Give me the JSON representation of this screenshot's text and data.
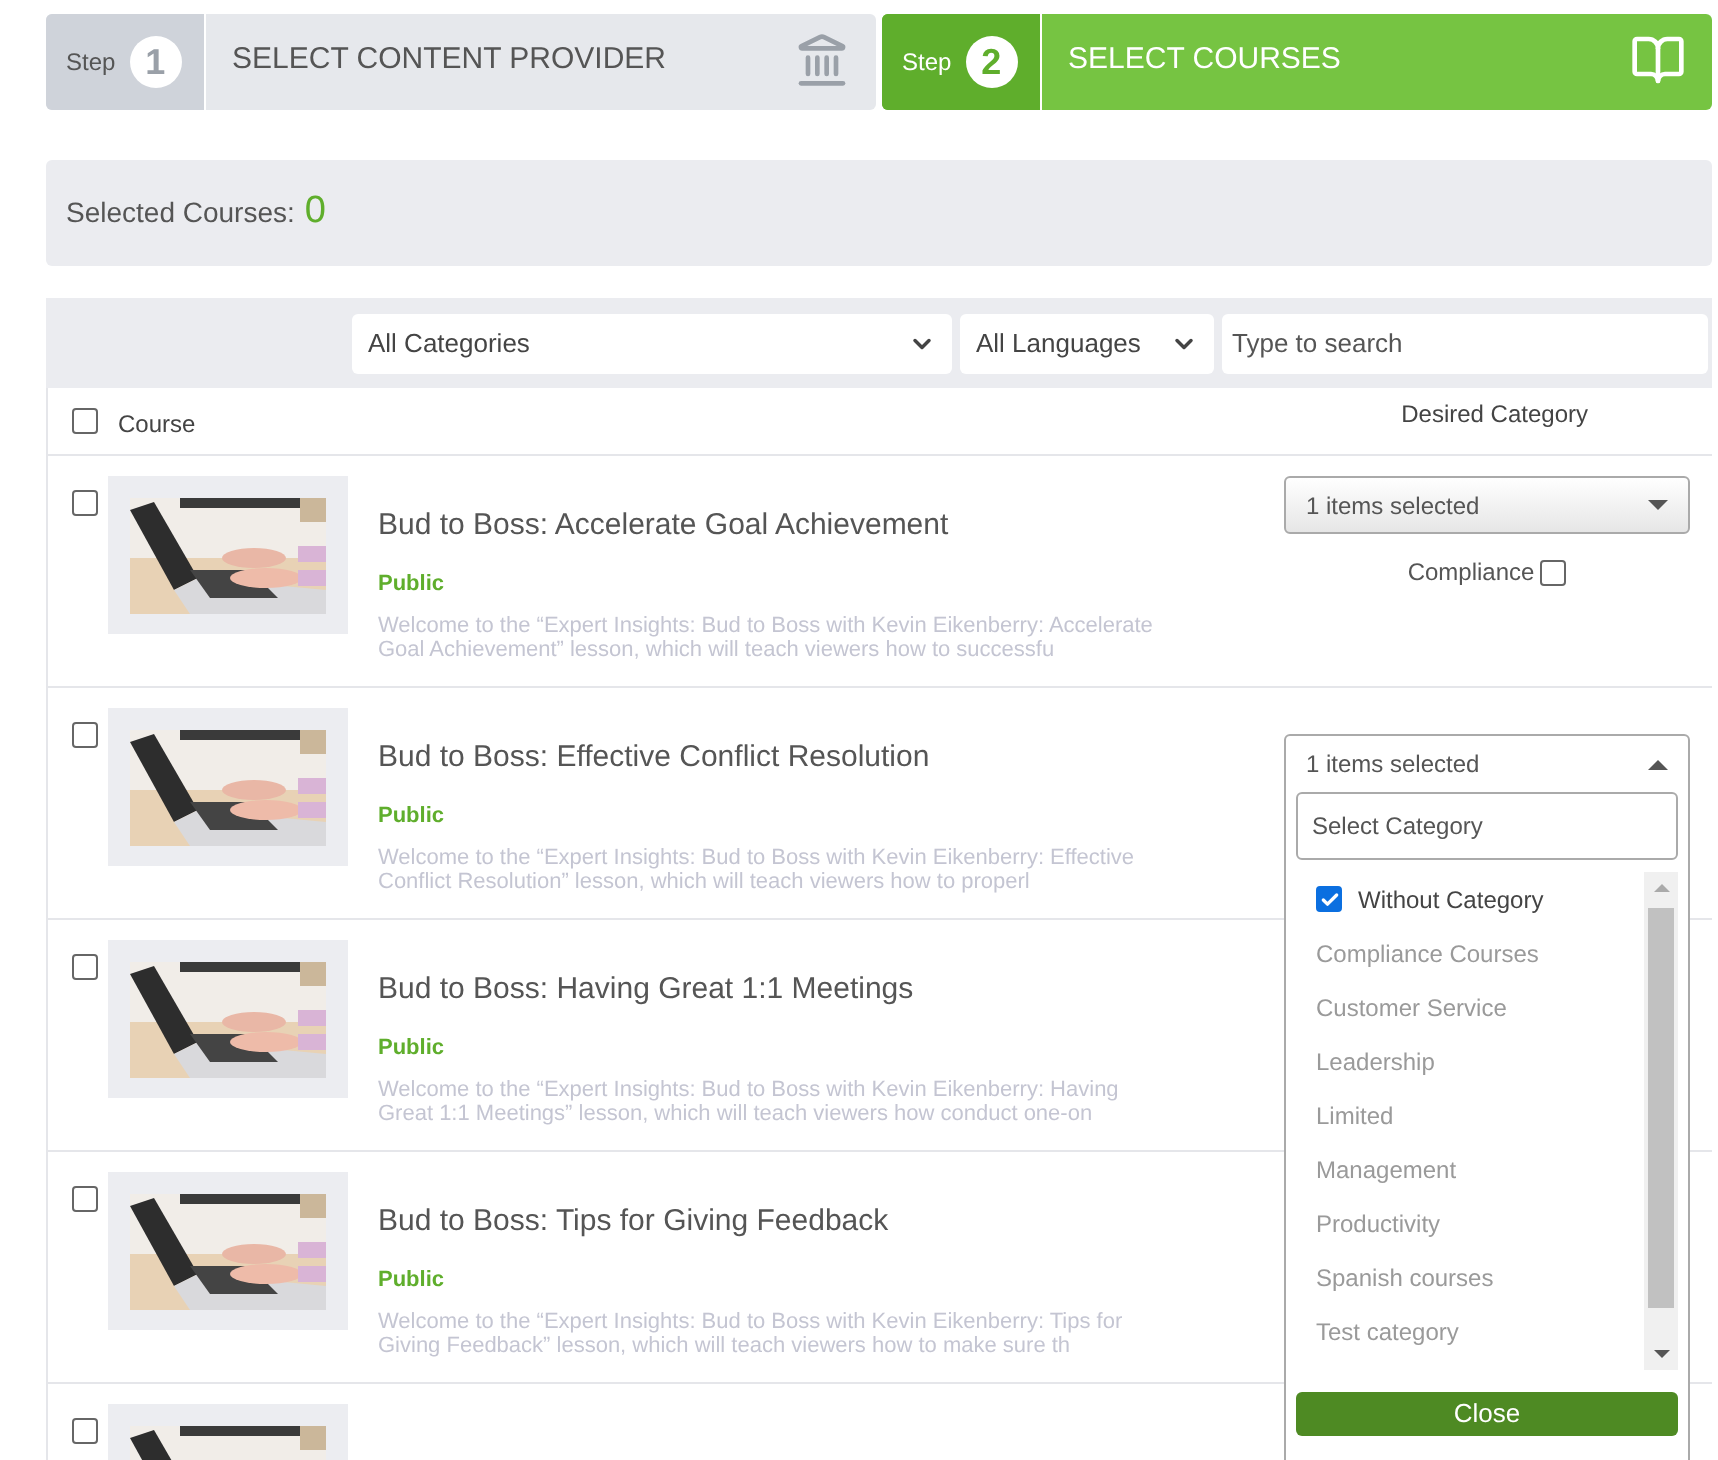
{
  "steps": [
    {
      "label": "Step",
      "number": "1",
      "title": "SELECT CONTENT PROVIDER",
      "selected": false
    },
    {
      "label": "Step",
      "number": "2",
      "title": "SELECT COURSES",
      "selected": true
    }
  ],
  "summary": {
    "label": "Selected Courses:",
    "count": "0"
  },
  "filters": {
    "category": "All Categories",
    "language": "All Languages",
    "search_placeholder": "Type to search"
  },
  "table": {
    "select_all_checked": false,
    "columns": [
      "Course",
      "Desired Category"
    ],
    "rows": [
      {
        "checked": false,
        "title": "Bud to Boss: Accelerate Goal Achievement",
        "visibility": "Public",
        "description": "Welcome to the “Expert Insights: Bud to Boss with Kevin Eikenberry: Accelerate Goal Achievement” lesson, which will teach viewers how to successfu",
        "category_select": "1 items selected",
        "expanded": false,
        "compliance": {
          "label": "Compliance",
          "checked": false
        }
      },
      {
        "checked": false,
        "title": "Bud to Boss: Effective Conflict Resolution",
        "visibility": "Public",
        "description": "Welcome to the “Expert Insights: Bud to Boss with Kevin Eikenberry: Effective Conflict Resolution” lesson, which will teach viewers how to properl",
        "category_select": "1 items selected",
        "expanded": true
      },
      {
        "checked": false,
        "title": "Bud to Boss: Having Great 1:1 Meetings",
        "visibility": "Public",
        "description": "Welcome to the “Expert Insights: Bud to Boss with Kevin Eikenberry: Having Great 1:1 Meetings” lesson, which will teach viewers how conduct one-on"
      },
      {
        "checked": false,
        "title": "Bud to Boss: Tips for Giving Feedback",
        "visibility": "Public",
        "description": "Welcome to the “Expert Insights: Bud to Boss with Kevin Eikenberry: Tips for Giving Feedback” lesson, which will teach viewers how to make sure th"
      },
      {
        "checked": false
      }
    ]
  },
  "category_dropdown": {
    "search_placeholder": "Select Category",
    "close": "Close",
    "items": [
      {
        "label": "Without Category",
        "checked": true,
        "disabled": false
      },
      {
        "label": "Compliance Courses",
        "checked": false,
        "disabled": true
      },
      {
        "label": "Customer Service",
        "checked": false,
        "disabled": true
      },
      {
        "label": "Leadership",
        "checked": false,
        "disabled": true
      },
      {
        "label": "Limited",
        "checked": false,
        "disabled": true
      },
      {
        "label": "Management",
        "checked": false,
        "disabled": true
      },
      {
        "label": "Productivity",
        "checked": false,
        "disabled": true
      },
      {
        "label": "Spanish courses",
        "checked": false,
        "disabled": true
      },
      {
        "label": "Test category",
        "checked": false,
        "disabled": true
      }
    ]
  }
}
